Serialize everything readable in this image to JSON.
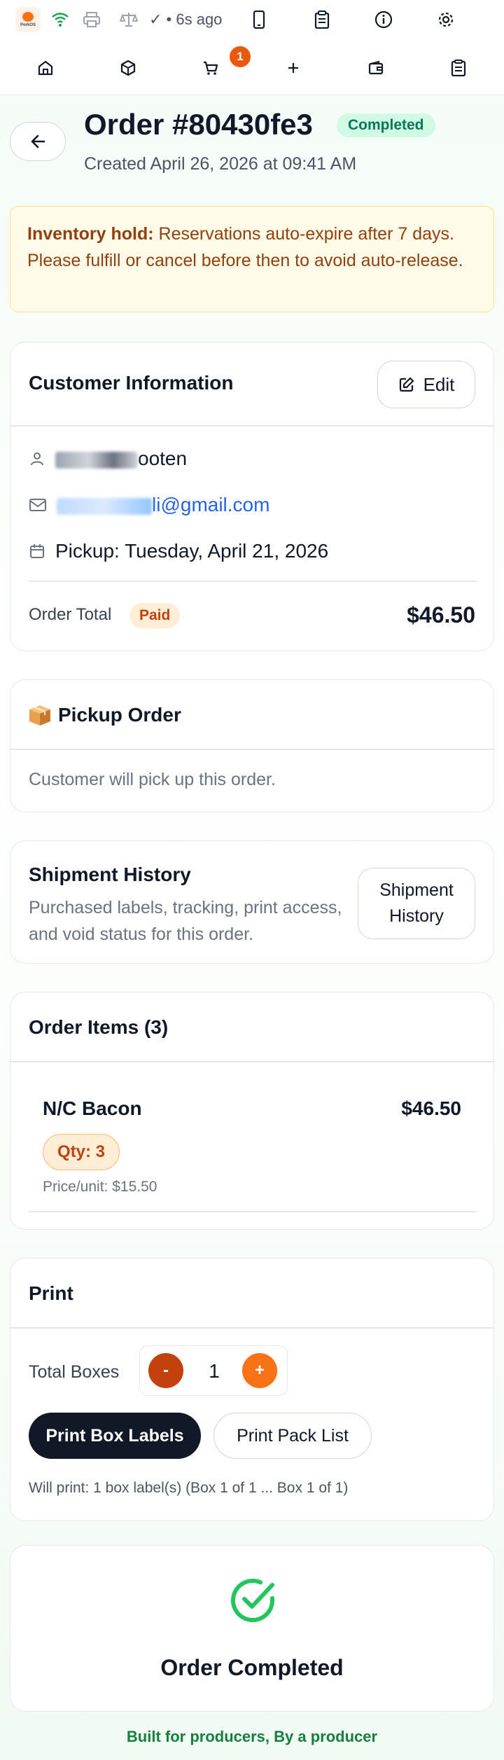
{
  "status_bar": {
    "sync_text": "✓ • 6s ago"
  },
  "nav": {
    "cart_count": "1"
  },
  "header": {
    "title": "Order #80430fe3",
    "status": "Completed",
    "created": "Created April 26, 2026 at 09:41 AM"
  },
  "alert": {
    "label": "Inventory hold:",
    "text": " Reservations auto-expire after 7 days. Please fulfill or cancel before then to avoid auto-release."
  },
  "customer": {
    "title": "Customer Information",
    "edit_label": "Edit",
    "name_visible": "ooten",
    "email_visible": "li@gmail.com",
    "pickup": "Pickup: Tuesday, April 21, 2026",
    "total_label": "Order Total",
    "payment_status": "Paid",
    "total": "$46.50"
  },
  "pickup": {
    "title": "Pickup Order",
    "note": "Customer will pick up this order."
  },
  "shipment": {
    "title": "Shipment History",
    "desc": "Purchased labels, tracking, print access, and void status for this order.",
    "button": "Shipment History"
  },
  "items": {
    "title": "Order Items (3)",
    "list": [
      {
        "name": "N/C Bacon",
        "price": "$46.50",
        "qty": "Qty: 3",
        "unit": "Price/unit: $15.50"
      }
    ]
  },
  "print": {
    "title": "Print",
    "boxes_label": "Total Boxes",
    "decrement": "-",
    "value": "1",
    "increment": "+",
    "box_labels_button": "Print Box Labels",
    "pack_list_button": "Print Pack List",
    "note": "Will print: 1 box label(s) (Box 1 of 1 ... Box 1 of 1)"
  },
  "completed": {
    "label": "Order Completed"
  },
  "footer": {
    "text": "Built for producers, By a producer"
  },
  "colors": {
    "accent_green": "#22c55e",
    "accent_orange": "#f97316",
    "dark_orange": "#c2410c",
    "link_blue": "#2563eb"
  }
}
